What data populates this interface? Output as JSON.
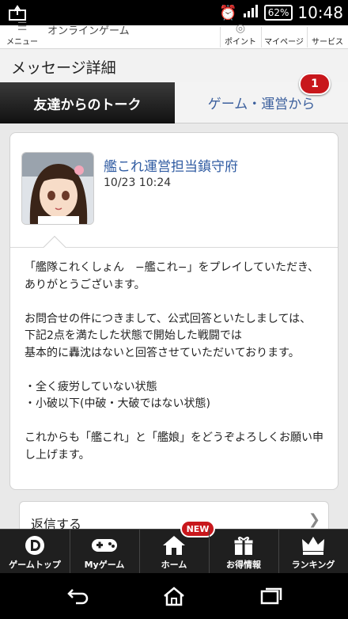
{
  "status_bar": {
    "battery": "62%",
    "time": "10:48"
  },
  "app_header": {
    "menu_label": "メニュー",
    "section_title": "オンラインゲーム",
    "points_label": "ポイント",
    "mypage_label": "マイページ",
    "service_label": "サービス"
  },
  "page": {
    "title": "メッセージ詳細"
  },
  "tabs": [
    {
      "label": "友達からのトーク",
      "active": true
    },
    {
      "label": "ゲーム・運営から",
      "active": false,
      "badge": "1"
    }
  ],
  "message": {
    "sender": "艦これ運営担当鎮守府",
    "date": "10/23 10:24",
    "paragraph_1": "「艦隊これくしょん　−艦これ−」をプレイしていただき、ありがとうございます。",
    "paragraph_2_line_1": "お問合せの件につきまして、公式回答といたしましては、",
    "paragraph_2_line_2": "下記2点を満たした状態で開始した戦闘では",
    "paragraph_2_line_3": "基本的に轟沈はないと回答させていただいております。",
    "bullet_1": "・全く疲労していない状態",
    "bullet_2": "・小破以下(中破・大破ではない状態)",
    "paragraph_3": "これからも「艦これ」と「艦娘」をどうぞよろしくお願い申し上げます。"
  },
  "reply": {
    "label": "返信する"
  },
  "bottom_nav": [
    {
      "label": "ゲームトップ",
      "icon": "d-logo-icon"
    },
    {
      "label": "Myゲーム",
      "icon": "gamepad-icon"
    },
    {
      "label": "ホーム",
      "icon": "home-icon",
      "badge": "NEW"
    },
    {
      "label": "お得情報",
      "icon": "gift-icon"
    },
    {
      "label": "ランキング",
      "icon": "crown-icon"
    }
  ],
  "colors": {
    "accent_red": "#c8171c",
    "link_blue": "#2f5ba2",
    "tab_dark": "#1a1a1a"
  }
}
